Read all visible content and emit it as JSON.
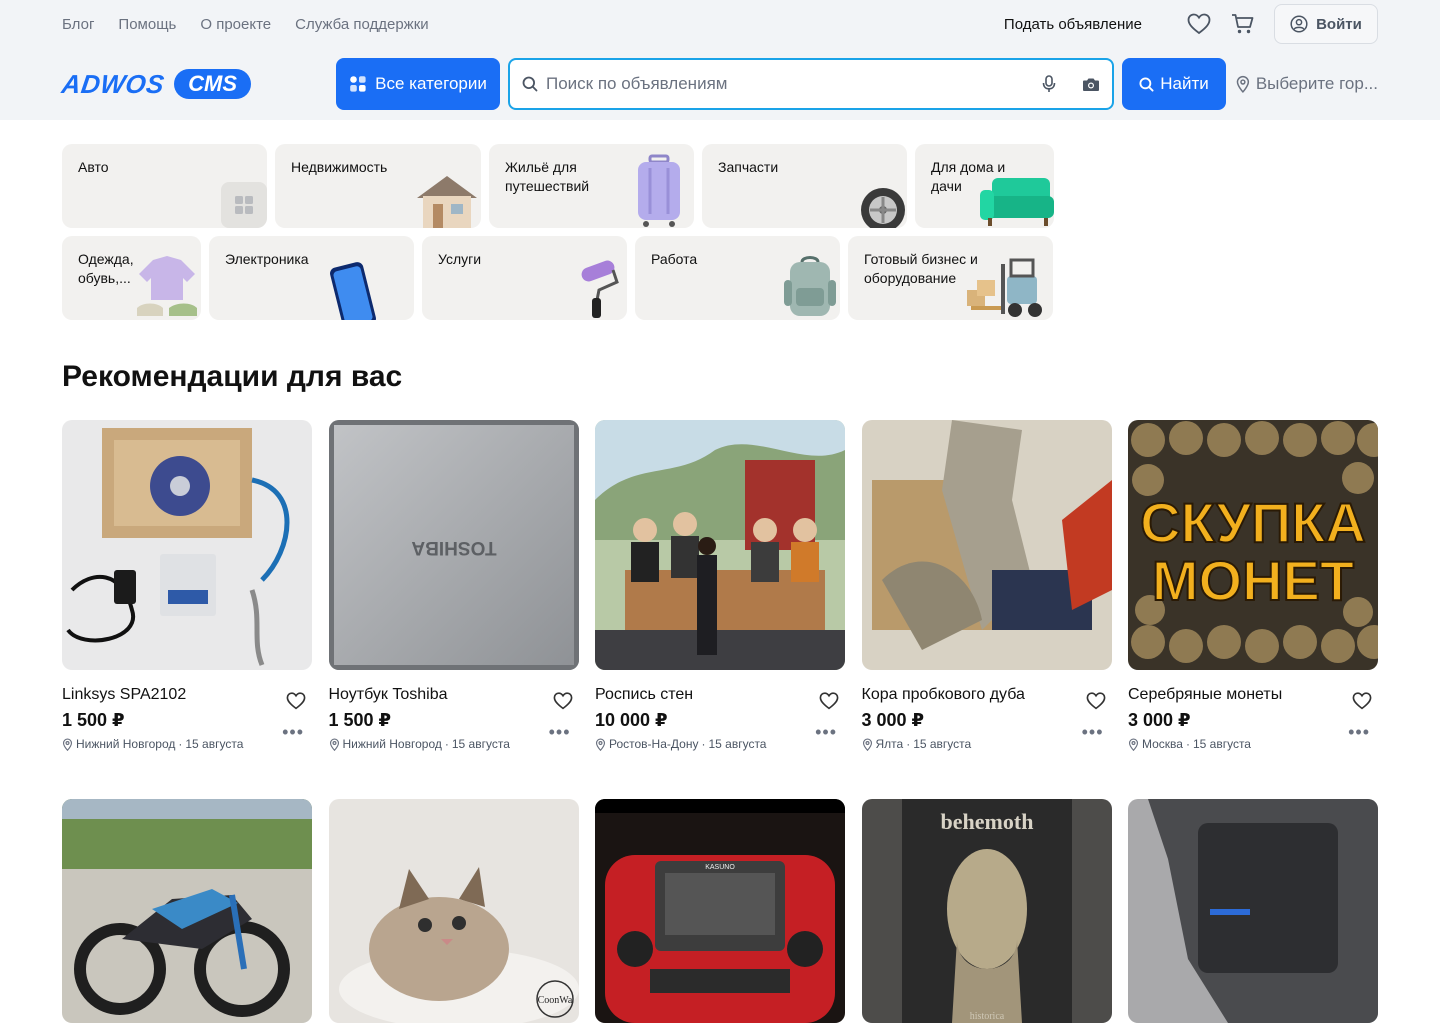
{
  "top_links": [
    "Блог",
    "Помощь",
    "О проекте",
    "Служба поддержки"
  ],
  "post_ad": "Подать объявление",
  "login": "Войти",
  "logo": {
    "word": "ADWOS",
    "pill": "CMS"
  },
  "all_categories": "Все категории",
  "search": {
    "placeholder": "Поиск по объявлениям",
    "value": ""
  },
  "find": "Найти",
  "city": "Выберите гор...",
  "categories_row1": [
    "Авто",
    "Недвижимость",
    "Жильё для путешествий",
    "Запчасти",
    "Для дома и дачи"
  ],
  "categories_row2": [
    "Одежда, обувь,...",
    "Электроника",
    "Услуги",
    "Работа",
    "Готовый бизнес и оборудование"
  ],
  "recommendations_title": "Рекомендации для вас",
  "listings": [
    {
      "title": "Linksys SPA2102",
      "price": "1 500 ₽",
      "city": "Нижний Новгород",
      "date": "15 августа"
    },
    {
      "title": "Ноутбук Toshiba",
      "price": "1 500 ₽",
      "city": "Нижний Новгород",
      "date": "15 августа"
    },
    {
      "title": "Роспись стен",
      "price": "10 000 ₽",
      "city": "Ростов-На-Дону",
      "date": "15 августа"
    },
    {
      "title": "Кора пробкового дуба",
      "price": "3 000 ₽",
      "city": "Ялта",
      "date": "15 августа"
    },
    {
      "title": "Серебряные монеты",
      "price": "3 000 ₽",
      "city": "Москва",
      "date": "15 августа"
    }
  ],
  "image_text": {
    "toshiba": "TOSHIBA",
    "coins_line1": "СКУПКА",
    "coins_line2": "МОНЕТ",
    "cat_watermark": "CoonWa",
    "radio_brand": "KASUNO",
    "poster_band": "behemoth",
    "poster_bottom": "historica"
  },
  "colors": {
    "accent": "#1a6ef5",
    "search_border": "#1aa3e8",
    "header_bg": "#f2f4f7",
    "tile_bg": "#f2f1ef"
  }
}
